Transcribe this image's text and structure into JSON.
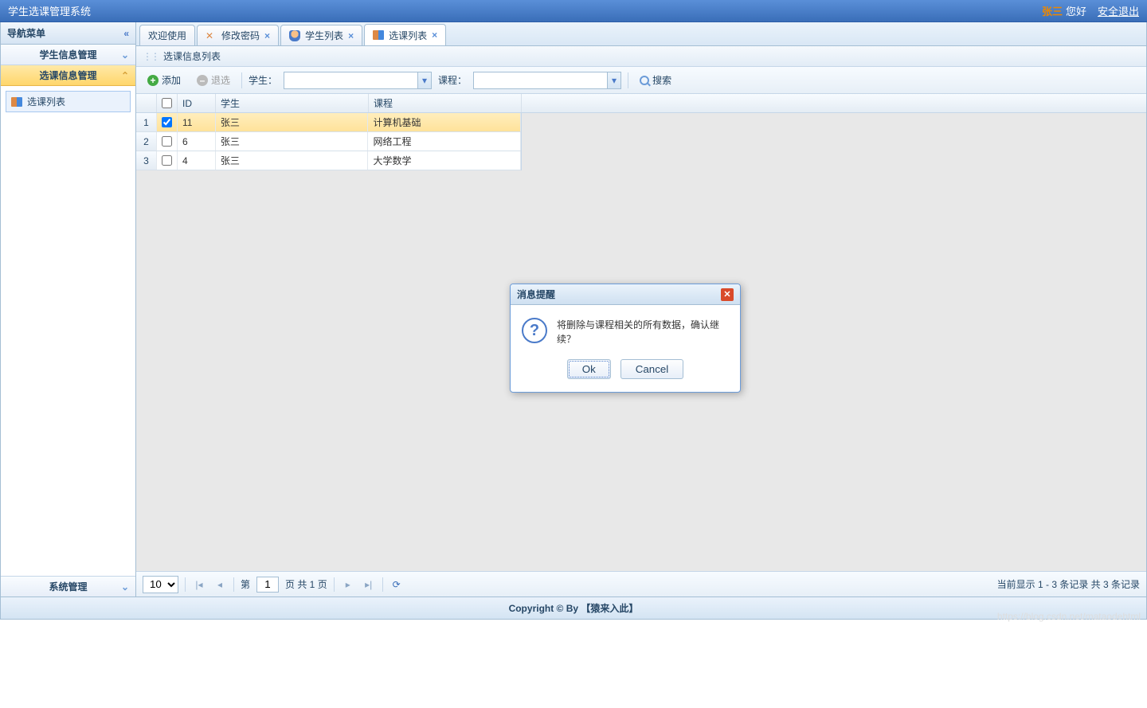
{
  "header": {
    "title": "学生选课管理系统",
    "user": "张三",
    "greet": "您好",
    "logout": "安全退出"
  },
  "sidebar": {
    "title": "导航菜单",
    "items": [
      {
        "label": "学生信息管理",
        "active": false
      },
      {
        "label": "选课信息管理",
        "active": true
      }
    ],
    "tree_node": "选课列表",
    "footer": "系统管理"
  },
  "tabs": [
    {
      "label": "欢迎使用",
      "icon": "none",
      "closable": false,
      "active": false
    },
    {
      "label": "修改密码",
      "icon": "wrench",
      "closable": true,
      "active": false
    },
    {
      "label": "学生列表",
      "icon": "user",
      "closable": true,
      "active": false
    },
    {
      "label": "选课列表",
      "icon": "book",
      "closable": true,
      "active": true
    }
  ],
  "panel": {
    "title": "选课信息列表"
  },
  "toolbar": {
    "add": "添加",
    "remove": "退选",
    "student_label": "学生：",
    "course_label": "课程：",
    "search": "搜索"
  },
  "grid": {
    "columns": {
      "id": "ID",
      "student": "学生",
      "course": "课程"
    },
    "rows": [
      {
        "num": "1",
        "checked": true,
        "selected": true,
        "id": "11",
        "student": "张三",
        "course": "计算机基础"
      },
      {
        "num": "2",
        "checked": false,
        "selected": false,
        "id": "6",
        "student": "张三",
        "course": "网络工程"
      },
      {
        "num": "3",
        "checked": false,
        "selected": false,
        "id": "4",
        "student": "张三",
        "course": "大学数学"
      }
    ]
  },
  "pager": {
    "size": "10",
    "page_prefix": "第",
    "page": "1",
    "page_suffix": "页 共 1 页",
    "info": "当前显示 1 - 3 条记录 共 3 条记录"
  },
  "footer": "Copyright © By 【猿来入此】",
  "dialog": {
    "title": "消息提醒",
    "message": "将删除与课程相关的所有数据，确认继续？",
    "ok": "Ok",
    "cancel": "Cancel"
  },
  "watermark": "https://blog.csdn.net/mataodehtml"
}
